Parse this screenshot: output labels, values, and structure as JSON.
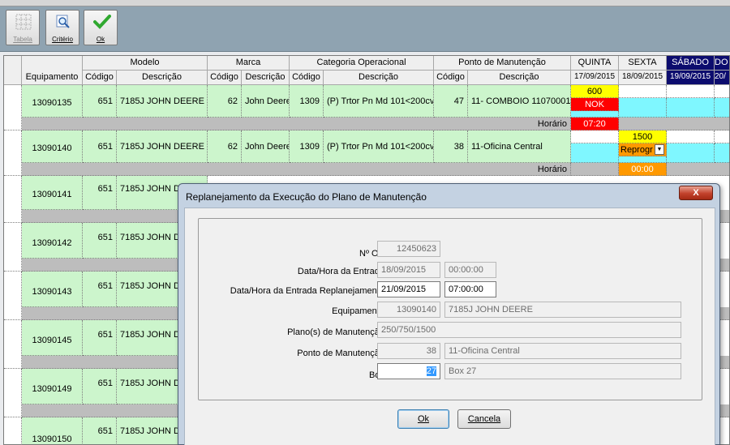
{
  "toolbar": {
    "tabela": "Tabela",
    "criterio": "Critério",
    "ok": "Ok"
  },
  "grid": {
    "headers": {
      "equipamento": "Equipamento",
      "modelo": "Modelo",
      "marca": "Marca",
      "categoria": "Categoria Operacional",
      "ponto": "Ponto de Manutenção",
      "codigo": "Código",
      "descricao": "Descrição"
    },
    "days": [
      {
        "name": "QUINTA",
        "date": "17/09/2015"
      },
      {
        "name": "SEXTA",
        "date": "18/09/2015"
      },
      {
        "name": "SÁBADO",
        "date": "19/09/2015"
      },
      {
        "name": "DO",
        "date": "20/"
      }
    ],
    "rows": [
      {
        "equip": "13090135",
        "modelo_cod": "651",
        "modelo_desc": "7185J JOHN DEERE",
        "marca_cod": "62",
        "marca_desc": "John Deere",
        "cat_cod": "1309",
        "cat_desc": "(P) Trtor Pn Md 101<200cv",
        "ponto_cod": "47",
        "ponto_desc": "11- COMBOIO 11070001",
        "horario": "Horário",
        "q1": "600",
        "q2": "NOK",
        "q3": "07:20"
      },
      {
        "equip": "13090140",
        "modelo_cod": "651",
        "modelo_desc": "7185J JOHN DEERE",
        "marca_cod": "62",
        "marca_desc": "John Deere",
        "cat_cod": "1309",
        "cat_desc": "(P) Trtor Pn Md 101<200cv",
        "ponto_cod": "38",
        "ponto_desc": "11-Oficina Central",
        "horario": "Horário",
        "s1": "1500",
        "s2": "Reprogr",
        "s3": "00:00"
      },
      {
        "equip": "13090141",
        "modelo_cod": "651",
        "modelo_desc": "7185J JOHN D"
      },
      {
        "equip": "13090142",
        "modelo_cod": "651",
        "modelo_desc": "7185J JOHN D"
      },
      {
        "equip": "13090143",
        "modelo_cod": "651",
        "modelo_desc": "7185J JOHN D"
      },
      {
        "equip": "13090145",
        "modelo_cod": "651",
        "modelo_desc": "7185J JOHN D"
      },
      {
        "equip": "13090149",
        "modelo_cod": "651",
        "modelo_desc": "7185J JOHN D"
      },
      {
        "equip": "13090150",
        "modelo_cod": "651",
        "modelo_desc": "7185J JOHN D"
      }
    ]
  },
  "dialog": {
    "title": "Replanejamento da Execução  do Plano de Manutenção",
    "close": "X",
    "labels": {
      "os": "Nº OS:",
      "entrada": "Data/Hora da Entrada:",
      "replan": "Data/Hora da Entrada Replanejamento:",
      "equip": "Equipamento:",
      "plano": "Plano(s) de Manutenção:",
      "ponto": "Ponto de Manutenção:",
      "box": "Box:"
    },
    "values": {
      "os": "12450623",
      "entrada_data": "18/09/2015",
      "entrada_hora": "00:00:00",
      "replan_data": "21/09/2015",
      "replan_hora": "07:00:00",
      "equip_cod": "13090140",
      "equip_desc": "7185J JOHN DEERE",
      "plano": "250/750/1500",
      "ponto_cod": "38",
      "ponto_desc": "11-Oficina Central",
      "box_cod": "27",
      "box_desc": "Box 27"
    },
    "buttons": {
      "ok": "Ok",
      "cancela": "Cancela"
    }
  }
}
